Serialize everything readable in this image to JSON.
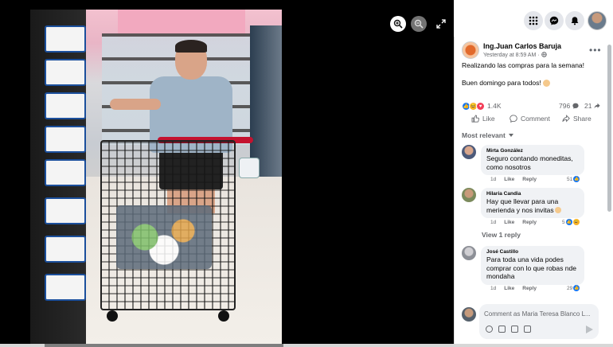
{
  "post": {
    "author": "Ing.Juan Carlos Baruja",
    "time": "Yesterday at 8:59 AM",
    "privacy_separator": "·",
    "text_line1": "Realizando las compras para la semana!",
    "text_line2": "Buen domingo para todos!",
    "reaction_count": "1.4K",
    "comment_count": "796",
    "share_count": "21",
    "reactions": [
      "like-icon",
      "haha-icon",
      "love-icon"
    ]
  },
  "actions": {
    "like": "Like",
    "comment": "Comment",
    "share": "Share"
  },
  "filter": {
    "label": "Most relevant"
  },
  "comments": [
    {
      "name": "Mirta González",
      "text": "Seguro contando moneditas, como nosotros",
      "time": "1d",
      "like": "Like",
      "reply": "Reply",
      "reactions": "51"
    },
    {
      "name": "Hilaria Candia",
      "text": "Hay que llevar para una merienda y nos invitas",
      "time": "1d",
      "like": "Like",
      "reply": "Reply",
      "reactions": "5"
    },
    {
      "name": "José Castillo",
      "text": "Para toda una vida podes comprar con lo que robas nde mondaha",
      "time": "1d",
      "like": "Like",
      "reply": "Reply",
      "reactions": "29"
    }
  ],
  "view_reply": "View 1 reply",
  "composer": {
    "placeholder": "Comment as Maria Teresa Blanco L..."
  },
  "colors": {
    "accent": "#1877f2",
    "love": "#f33e58",
    "haha": "#f7b125",
    "bubble": "#f0f2f5"
  }
}
